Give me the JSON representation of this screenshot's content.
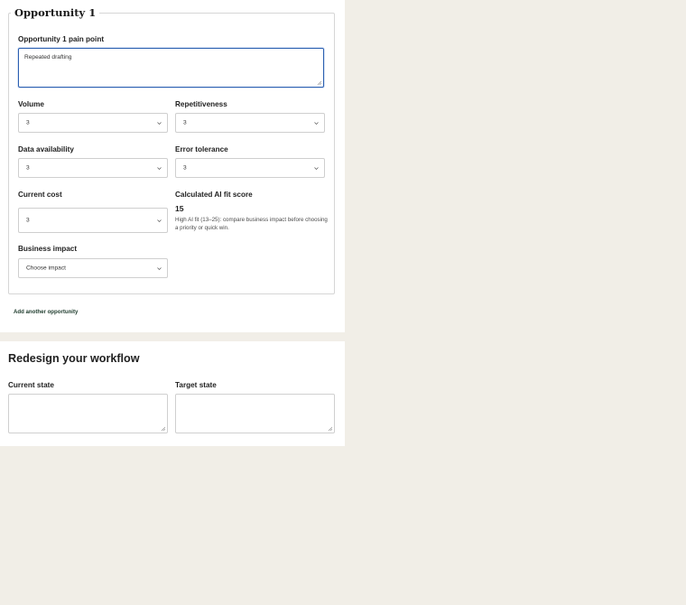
{
  "opportunity": {
    "legend": "Opportunity 1",
    "pain_point_label": "Opportunity 1 pain point",
    "pain_point_value": "Repeated drafting",
    "volume_label": "Volume",
    "volume_value": "3",
    "repetitiveness_label": "Repetitiveness",
    "repetitiveness_value": "3",
    "data_availability_label": "Data availability",
    "data_availability_value": "3",
    "error_tolerance_label": "Error tolerance",
    "error_tolerance_value": "3",
    "current_cost_label": "Current cost",
    "current_cost_value": "3",
    "score_label": "Calculated AI fit score",
    "score_value": "15",
    "score_help": "High AI fit (13–25): compare business impact before choosing a priority or quick win.",
    "business_impact_label": "Business impact",
    "business_impact_value": "Choose impact"
  },
  "add_opportunity_label": "Add another opportunity",
  "workflow": {
    "title": "Redesign your workflow",
    "current_state_label": "Current state",
    "current_state_value": "",
    "target_state_label": "Target state",
    "target_state_value": ""
  },
  "colors": {
    "background": "#f1eee7",
    "panel": "#ffffff",
    "focus_border": "#2b5fb0",
    "link": "#1c3a2b"
  }
}
